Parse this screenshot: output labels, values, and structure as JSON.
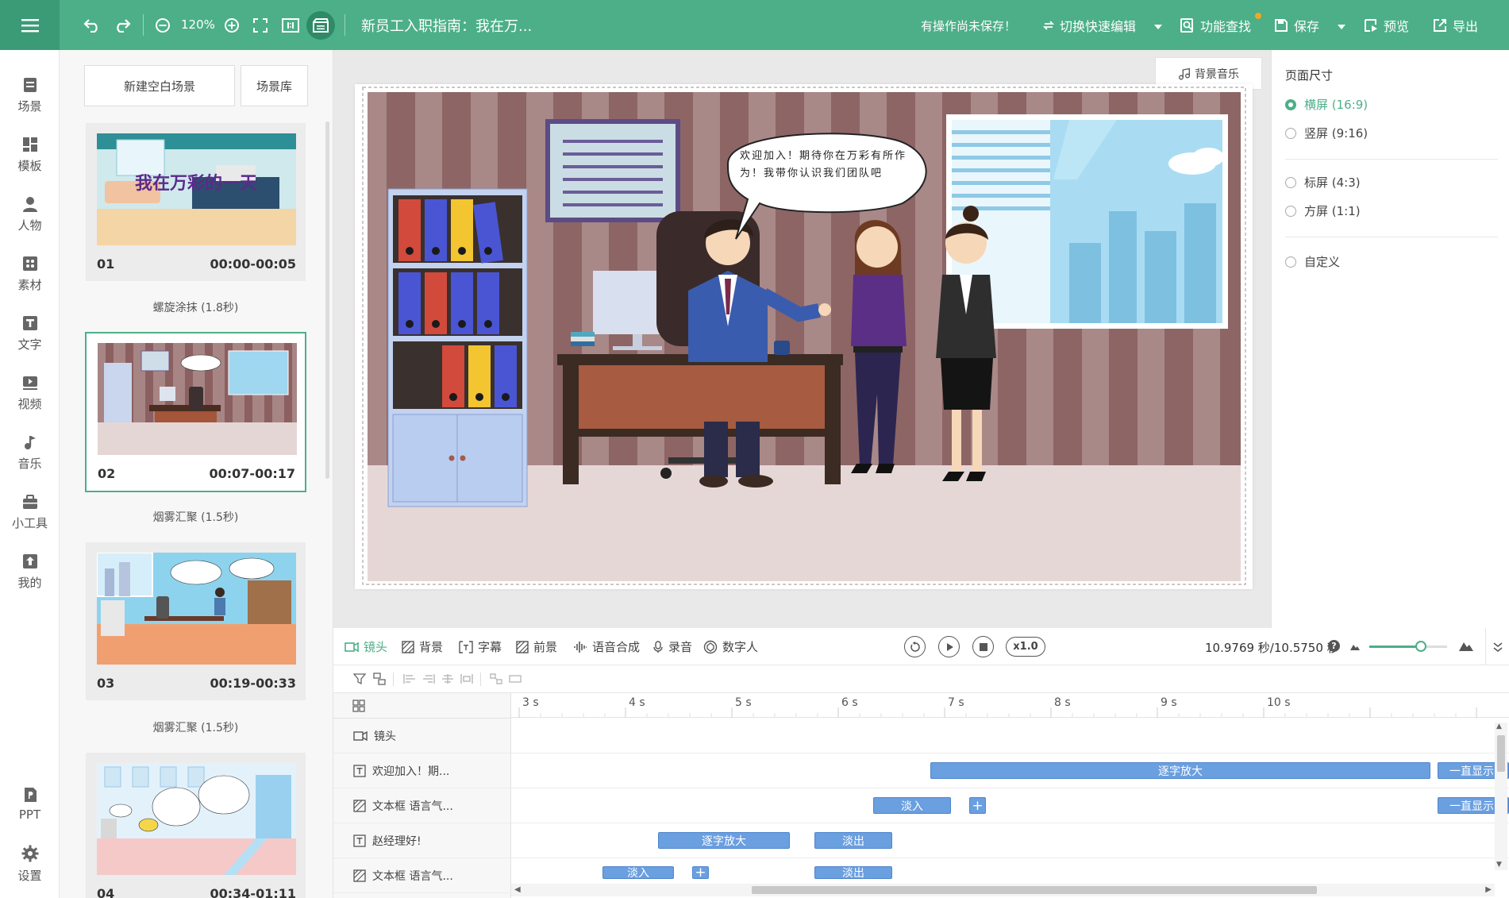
{
  "topbar": {
    "zoom": "120%",
    "doc_title": "新员工入职指南：我在万...",
    "unsaved_notice": "有操作尚未保存！",
    "quick_edit": "切换快速编辑",
    "feature_search": "功能查找",
    "save": "保存",
    "preview": "预览",
    "export": "导出"
  },
  "rail": [
    {
      "label": "场景",
      "icon": "scene-icon"
    },
    {
      "label": "模板",
      "icon": "template-icon"
    },
    {
      "label": "人物",
      "icon": "person-icon"
    },
    {
      "label": "素材",
      "icon": "material-icon"
    },
    {
      "label": "文字",
      "icon": "text-icon"
    },
    {
      "label": "视频",
      "icon": "video-icon"
    },
    {
      "label": "音乐",
      "icon": "music-icon"
    },
    {
      "label": "小工具",
      "icon": "toolbox-icon"
    },
    {
      "label": "我的",
      "icon": "upload-icon"
    },
    {
      "label": "PPT",
      "icon": "ppt-icon"
    },
    {
      "label": "设置",
      "icon": "settings-icon"
    }
  ],
  "scenes": {
    "new_blank": "新建空白场景",
    "library": "场景库",
    "cards": [
      {
        "num": "01",
        "time": "00:00-00:05",
        "thumb_title": "我在万彩的一天"
      },
      {
        "num": "02",
        "time": "00:07-00:17"
      },
      {
        "num": "03",
        "time": "00:19-00:33"
      },
      {
        "num": "04",
        "time": "00:34-01:11"
      }
    ],
    "transitions": [
      "螺旋涂抹 (1.8秒)",
      "烟雾汇聚 (1.5秒)",
      "烟雾汇聚 (1.5秒)"
    ]
  },
  "canvas": {
    "bg_music": "背景音乐",
    "speech_bubble": "欢迎加入！期待你在万彩有所作为！我带你认识我们团队吧"
  },
  "page_size": {
    "title": "页面尺寸",
    "options": [
      {
        "label": "横屏 (16:9)",
        "selected": true
      },
      {
        "label": "竖屏 (9:16)",
        "selected": false
      },
      {
        "label": "标屏 (4:3)",
        "selected": false
      },
      {
        "label": "方屏 (1:1)",
        "selected": false
      },
      {
        "label": "自定义",
        "selected": false
      }
    ]
  },
  "timeline": {
    "tabs": [
      "镜头",
      "背景",
      "字幕",
      "前景",
      "语音合成",
      "录音",
      "数字人"
    ],
    "speed": "x1.0",
    "time_readout": "10.9769 秒/10.5750 秒",
    "ruler": [
      "3 s",
      "4 s",
      "5 s",
      "6 s",
      "7 s",
      "8 s",
      "9 s",
      "10 s"
    ],
    "tracks": [
      "镜头",
      "欢迎加入！期...",
      "文本框 语言气...",
      "赵经理好!",
      "文本框 语言气..."
    ],
    "clips": {
      "zoom_in": "逐字放大",
      "fade_in": "淡入",
      "fade_out": "淡出",
      "always_show": "一直显示",
      "plus": "+"
    }
  },
  "colors": {
    "accent": "#4caf88",
    "clip": "#6a9fe0"
  }
}
